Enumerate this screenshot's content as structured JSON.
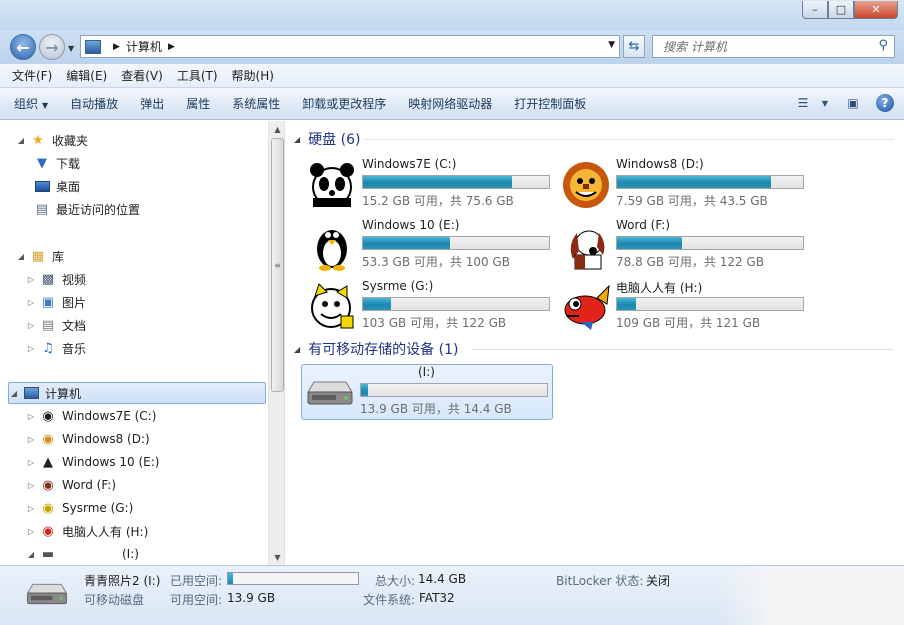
{
  "title": {
    "caption_buttons": [
      "–",
      "□",
      "✕"
    ]
  },
  "address": {
    "crumb": "计算机",
    "search_placeholder": "搜索 计算机"
  },
  "menu": [
    "文件(F)",
    "编辑(E)",
    "查看(V)",
    "工具(T)",
    "帮助(H)"
  ],
  "commands": {
    "organize": "组织",
    "autoplay": "自动播放",
    "eject": "弹出",
    "properties": "属性",
    "system_properties": "系统属性",
    "uninstall": "卸载或更改程序",
    "map_drive": "映射网络驱动器",
    "control_panel": "打开控制面板"
  },
  "nav": {
    "favorites": "收藏夹",
    "downloads": "下载",
    "desktop": "桌面",
    "recent": "最近访问的位置",
    "library": "库",
    "videos": "视频",
    "pictures": "图片",
    "documents": "文档",
    "music": "音乐",
    "computer": "计算机",
    "drives": [
      "Windows7E (C:)",
      "Windows8 (D:)",
      "Windows 10 (E:)",
      "Word (F:)",
      "Sysrme (G:)",
      "电脑人人有 (H:)",
      "(I:)"
    ]
  },
  "groups": {
    "hdd": "硬盘 (6)",
    "removable": "有可移动存储的设备 (1)"
  },
  "drives": [
    {
      "name": "Windows7E (C:)",
      "info": "15.2 GB 可用，共 75.6 GB",
      "used": 0.8,
      "icon": "panda-icon"
    },
    {
      "name": "Windows8 (D:)",
      "info": "7.59 GB 可用，共 43.5 GB",
      "used": 0.83,
      "icon": "lion-icon"
    },
    {
      "name": "Windows 10 (E:)",
      "info": "53.3 GB 可用，共 100 GB",
      "used": 0.47,
      "icon": "penguin-icon"
    },
    {
      "name": "Word (F:)",
      "info": "78.8 GB 可用，共 122 GB",
      "used": 0.35,
      "icon": "dog-icon"
    },
    {
      "name": "Sysrme (G:)",
      "info": "103 GB 可用，共 122 GB",
      "used": 0.15,
      "icon": "cat-icon"
    },
    {
      "name": "电脑人人有 (H:)",
      "info": "109 GB 可用，共 121 GB",
      "used": 0.1,
      "icon": "fish-icon"
    }
  ],
  "removable": {
    "name": "(I:)",
    "info": "13.9 GB 可用，共 14.4 GB",
    "used": 0.04
  },
  "details": {
    "name": "青青照片2 (I:)",
    "type": "可移动磁盘",
    "used_label": "已用空间:",
    "free_label": "可用空间:",
    "free_value": "13.9 GB",
    "total_label": "总大小:",
    "total_value": "14.4 GB",
    "fs_label": "文件系统:",
    "fs_value": "FAT32",
    "bitlocker_label": "BitLocker 状态:",
    "bitlocker_value": "关闭",
    "used_fraction": 0.04
  }
}
